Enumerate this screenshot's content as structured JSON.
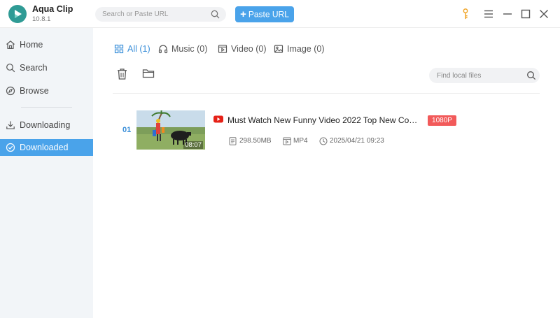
{
  "app": {
    "name": "Aqua Clip",
    "version": "10.8.1"
  },
  "header": {
    "search_placeholder": "Search or Paste URL",
    "paste_label": "Paste URL",
    "accent_color": "#4aa3ea"
  },
  "sidebar": {
    "items": [
      {
        "label": "Home",
        "icon": "home-icon"
      },
      {
        "label": "Search",
        "icon": "search-icon"
      },
      {
        "label": "Browse",
        "icon": "compass-icon"
      },
      {
        "label": "Downloading",
        "icon": "download-icon"
      },
      {
        "label": "Downloaded",
        "icon": "check-circle-icon",
        "active": true
      }
    ]
  },
  "tabs": [
    {
      "label": "All (1)",
      "icon": "grid-icon",
      "active": true
    },
    {
      "label": "Music (0)",
      "icon": "headphones-icon"
    },
    {
      "label": "Video (0)",
      "icon": "video-icon"
    },
    {
      "label": "Image (0)",
      "icon": "image-icon"
    }
  ],
  "toolbar": {
    "local_search_placeholder": "Find local files"
  },
  "downloads": [
    {
      "index": "01",
      "duration": "08:07",
      "title": "Must Watch New Funny Video 2022 Top New Com...",
      "quality": "1080P",
      "size": "298.50MB",
      "format": "MP4",
      "date": "2025/04/21 09:23",
      "source_icon": "youtube-icon"
    }
  ],
  "colors": {
    "quality_badge": "#f25a5a",
    "active_tab": "#3b8fd9"
  }
}
